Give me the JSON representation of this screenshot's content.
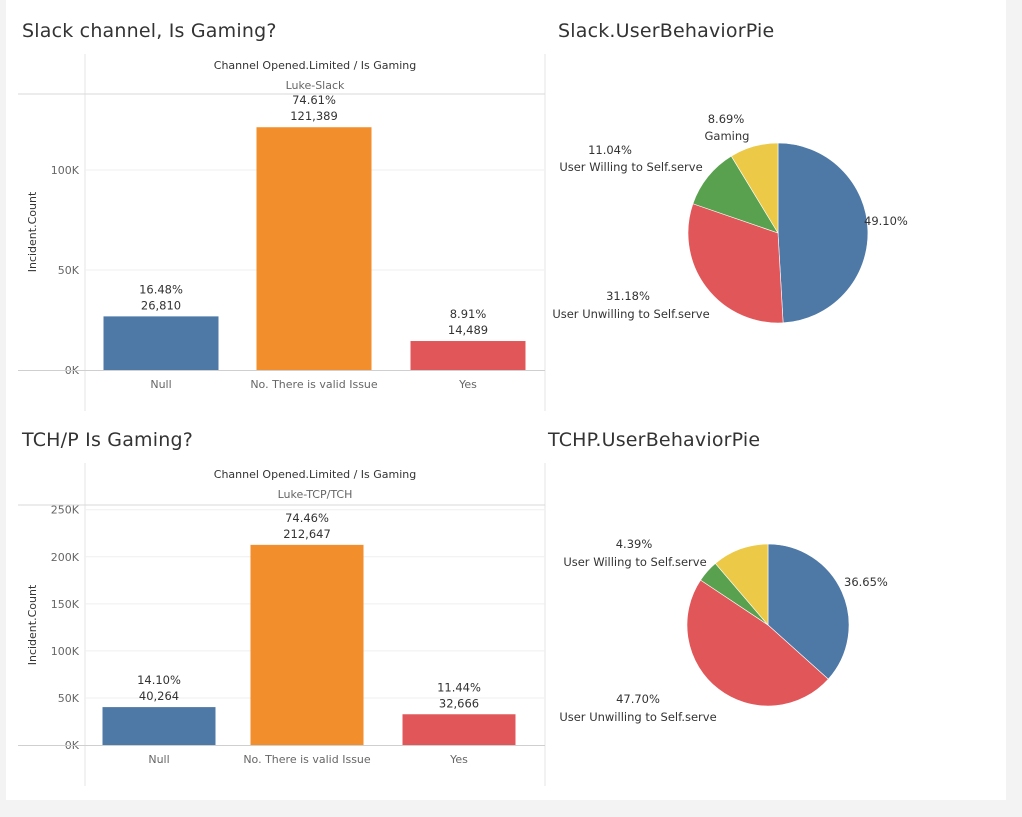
{
  "titles": {
    "slack_bar": "Slack channel, Is Gaming?",
    "slack_pie": "Slack.UserBehaviorPie",
    "tchp_bar": "TCH/P Is Gaming?",
    "tchp_pie": "TCHP.UserBehaviorPie"
  },
  "colors": {
    "blue": "#4e79a7",
    "orange": "#f28e2b",
    "red": "#e15759",
    "green": "#59a14f",
    "yellow": "#edc948"
  },
  "chart_data": [
    {
      "id": "slack_bar",
      "type": "bar",
      "title": "Slack channel, Is Gaming?",
      "header": "Channel Opened.Limited / Is Gaming",
      "subheader": "Luke-Slack",
      "ylabel": "Incident.Count",
      "categories": [
        "Null",
        "No. There is valid Issue",
        "Yes"
      ],
      "values": [
        26810,
        121389,
        14489
      ],
      "value_labels": [
        "26,810",
        "121,389",
        "14,489"
      ],
      "percent_labels": [
        "16.48%",
        "74.61%",
        "8.91%"
      ],
      "bar_colors": [
        "#4e79a7",
        "#f28e2b",
        "#e15759"
      ],
      "ylim": [
        0,
        138000
      ],
      "yticks": [
        0,
        50000,
        100000
      ],
      "ytick_labels": [
        "0K",
        "50K",
        "100K"
      ],
      "grid": true
    },
    {
      "id": "slack_pie",
      "type": "pie",
      "title": "Slack.UserBehaviorPie",
      "slices": [
        {
          "label": "",
          "percent_label": "49.10%",
          "value": 49.1,
          "color": "#4e79a7"
        },
        {
          "label": "User Unwilling to Self.serve",
          "percent_label": "31.18%",
          "value": 31.18,
          "color": "#e15759"
        },
        {
          "label": "User Willing to Self.serve",
          "percent_label": "11.04%",
          "value": 11.04,
          "color": "#59a14f"
        },
        {
          "label": "Gaming",
          "percent_label": "8.69%",
          "value": 8.69,
          "color": "#edc948"
        }
      ]
    },
    {
      "id": "tchp_bar",
      "type": "bar",
      "title": "TCH/P Is Gaming?",
      "header": "Channel Opened.Limited / Is Gaming",
      "subheader": "Luke-TCP/TCH",
      "ylabel": "Incident.Count",
      "categories": [
        "Null",
        "No. There is valid Issue",
        "Yes"
      ],
      "values": [
        40264,
        212647,
        32666
      ],
      "value_labels": [
        "40,264",
        "212,647",
        "32,666"
      ],
      "percent_labels": [
        "14.10%",
        "74.46%",
        "11.44%"
      ],
      "bar_colors": [
        "#4e79a7",
        "#f28e2b",
        "#e15759"
      ],
      "ylim": [
        0,
        255000
      ],
      "yticks": [
        0,
        50000,
        100000,
        150000,
        200000,
        250000
      ],
      "ytick_labels": [
        "0K",
        "50K",
        "100K",
        "150K",
        "200K",
        "250K"
      ],
      "grid": true
    },
    {
      "id": "tchp_pie",
      "type": "pie",
      "title": "TCHP.UserBehaviorPie",
      "slices": [
        {
          "label": "",
          "percent_label": "36.65%",
          "value": 36.65,
          "color": "#4e79a7"
        },
        {
          "label": "User Unwilling to Self.serve",
          "percent_label": "47.70%",
          "value": 47.7,
          "color": "#e15759"
        },
        {
          "label": "User Willing to Self.serve",
          "percent_label": "4.39%",
          "value": 4.39,
          "color": "#59a14f"
        },
        {
          "label": "",
          "percent_label": "",
          "value": 11.26,
          "color": "#edc948"
        }
      ]
    }
  ]
}
